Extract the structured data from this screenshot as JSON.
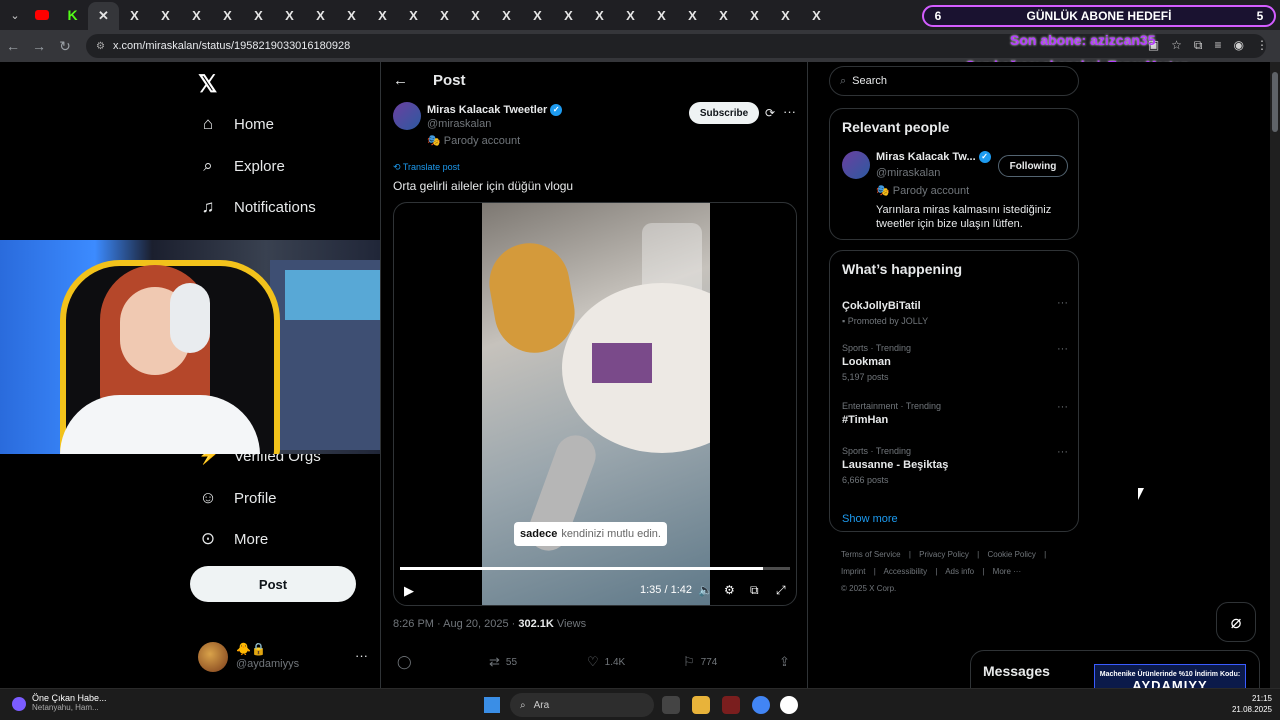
{
  "browser": {
    "url": "x.com/miraskalan/status/1958219033016180928",
    "tabs": [
      "X",
      "X",
      "X",
      "X",
      "X",
      "X",
      "X",
      "X",
      "X",
      "X",
      "X",
      "X",
      "X",
      "X",
      "X",
      "X",
      "X",
      "X",
      "X",
      "X",
      "X",
      "X",
      "X",
      "X",
      "X",
      "X"
    ]
  },
  "overlay": {
    "goal_left": "6",
    "goal_title": "GÜNLÜK ABONE HEDEFİ",
    "goal_right": "5",
    "last_sub": "Son abone: azizcan35",
    "last_donor": "Son bağışçı aboneleri: ToneyMarton"
  },
  "nav": {
    "home": "Home",
    "explore": "Explore",
    "notifications": "Notifications",
    "verified_orgs": "Verified Orgs",
    "profile": "Profile",
    "more": "More",
    "post_button": "Post",
    "account_name": "🐥🔒",
    "account_handle": "@aydamiyys"
  },
  "post": {
    "header": "Post",
    "author_name": "Miras Kalacak Tweetler",
    "author_handle": "@miraskalan",
    "parody_label": "Parody account",
    "subscribe_label": "Subscribe",
    "translate_label": "Translate post",
    "text": "Orta gelirli aileler için düğün vlogu",
    "video": {
      "caption_bold": "sadece",
      "caption_rest": "kendinizi mutlu edin.",
      "time": "1:35 / 1:42",
      "progress": 0.93
    },
    "timestamp": "8:26 PM · Aug 20, 2025 ·",
    "views_count": "302.1K",
    "views_label": "Views",
    "reposts": "55",
    "likes": "1.4K",
    "bookmarks": "774"
  },
  "sidebar": {
    "search_placeholder": "Search",
    "relevant_title": "Relevant people",
    "rp_name": "Miras Kalacak Tw...",
    "rp_handle": "@miraskalan",
    "rp_parody": "Parody account",
    "rp_bio": "Yarınlara miras kalmasını istediğiniz tweetler için bize ulaşın lütfen.",
    "following_label": "Following",
    "happening_title": "What’s happening",
    "trends": [
      {
        "sub": "",
        "title": "ÇokJollyBiTatil",
        "count": "Promoted by JOLLY"
      },
      {
        "sub": "Sports · Trending",
        "title": "Lookman",
        "count": "5,197 posts"
      },
      {
        "sub": "Entertainment · Trending",
        "title": "#TimHan",
        "count": ""
      },
      {
        "sub": "Sports · Trending",
        "title": "Lausanne - Beşiktaş",
        "count": "6,666 posts"
      }
    ],
    "show_more": "Show more",
    "footer": [
      "Terms of Service",
      "|",
      "Privacy Policy",
      "|",
      "Cookie Policy",
      "|",
      "Imprint",
      "|",
      "Accessibility",
      "|",
      "Ads info",
      "|",
      "More ···"
    ],
    "copyright": "© 2025 X Corp."
  },
  "messages": {
    "title": "Messages"
  },
  "promo": {
    "line1": "Machenike Ürünlerinde %10 İndirim Kodu:",
    "code": "AYDAMIYY"
  },
  "taskbar": {
    "news_title": "Öne Çıkan Habe...",
    "news_sub": "Netanyahu, Ham...",
    "search_label": "Ara",
    "time": "21:15",
    "date": "21.08.2025"
  }
}
